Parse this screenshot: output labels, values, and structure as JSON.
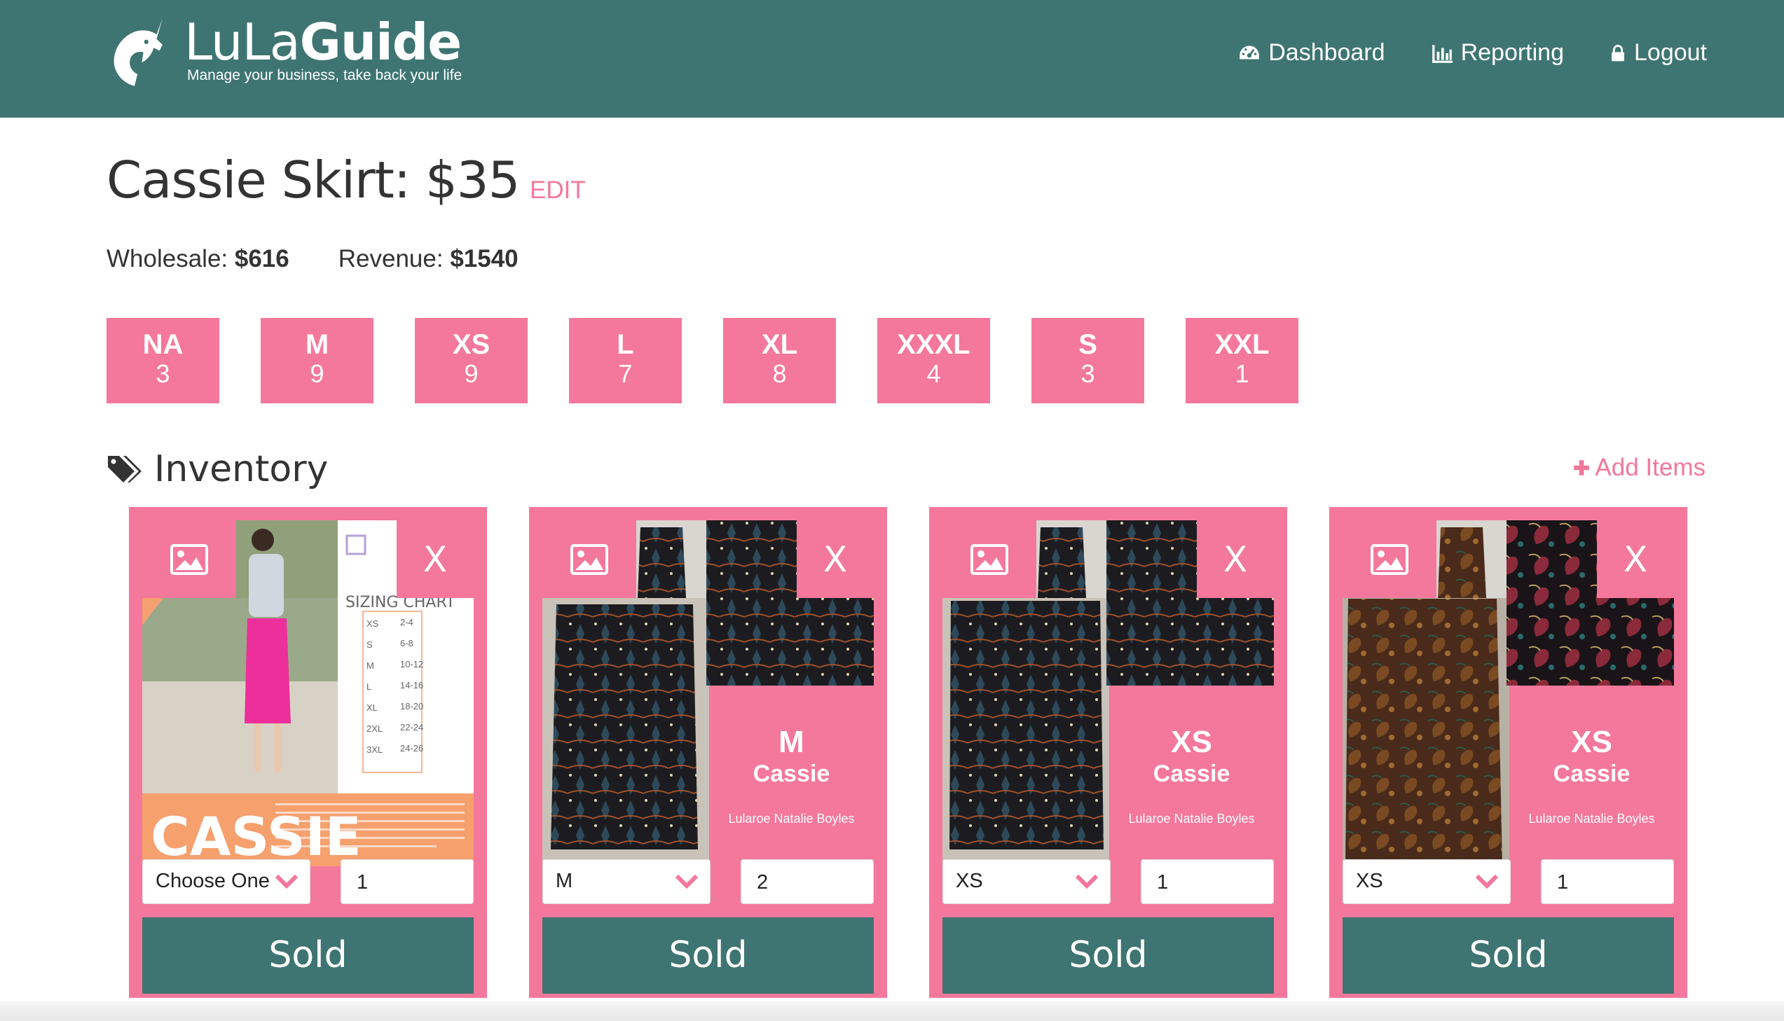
{
  "header": {
    "logo_light": "LuLa",
    "logo_bold": "Guide",
    "tagline": "Manage your business, take back your life",
    "nav": [
      {
        "label": "Dashboard",
        "icon": "dashboard-icon"
      },
      {
        "label": "Reporting",
        "icon": "bar-chart-icon"
      },
      {
        "label": "Logout",
        "icon": "lock-icon"
      }
    ]
  },
  "product": {
    "title": "Cassie Skirt: $35",
    "edit_label": "EDIT",
    "wholesale_label": "Wholesale:",
    "wholesale_value": "$616",
    "revenue_label": "Revenue:",
    "revenue_value": "$1540"
  },
  "sizes": [
    {
      "size": "NA",
      "count": "3"
    },
    {
      "size": "M",
      "count": "9"
    },
    {
      "size": "XS",
      "count": "9"
    },
    {
      "size": "L",
      "count": "7"
    },
    {
      "size": "XL",
      "count": "8"
    },
    {
      "size": "XXXL",
      "count": "4"
    },
    {
      "size": "S",
      "count": "3"
    },
    {
      "size": "XXL",
      "count": "1"
    }
  ],
  "inventory": {
    "heading": "Inventory",
    "add_label": "Add Items",
    "cards": [
      {
        "size": "",
        "name": "",
        "seller": "",
        "select_value": "Choose One",
        "qty": "1",
        "sold_label": "Sold",
        "remove_label": "X",
        "photo": "sizing-chart"
      },
      {
        "size": "M",
        "name": "Cassie",
        "seller": "Lularoe Natalie Boyles",
        "select_value": "M",
        "qty": "2",
        "sold_label": "Sold",
        "remove_label": "X",
        "photo": "black-pattern"
      },
      {
        "size": "XS",
        "name": "Cassie",
        "seller": "Lularoe Natalie Boyles",
        "select_value": "XS",
        "qty": "1",
        "sold_label": "Sold",
        "remove_label": "X",
        "photo": "black-pattern"
      },
      {
        "size": "XS",
        "name": "Cassie",
        "seller": "Lularoe Natalie Boyles",
        "select_value": "XS",
        "qty": "1",
        "sold_label": "Sold",
        "remove_label": "X",
        "photo": "paisley"
      }
    ]
  },
  "promo_graphic": {
    "word": "CASSIE",
    "chart_title": "SIZING CHART",
    "chart_rows": [
      [
        "XS",
        "2-4"
      ],
      [
        "S",
        "6-8"
      ],
      [
        "M",
        "10-12"
      ],
      [
        "L",
        "14-16"
      ],
      [
        "XL",
        "18-20"
      ],
      [
        "2XL",
        "22-24"
      ],
      [
        "3XL",
        "24-26"
      ]
    ]
  },
  "colors": {
    "teal": "#3e7572",
    "pink": "#f4789b",
    "link_pink": "#f2789a"
  }
}
